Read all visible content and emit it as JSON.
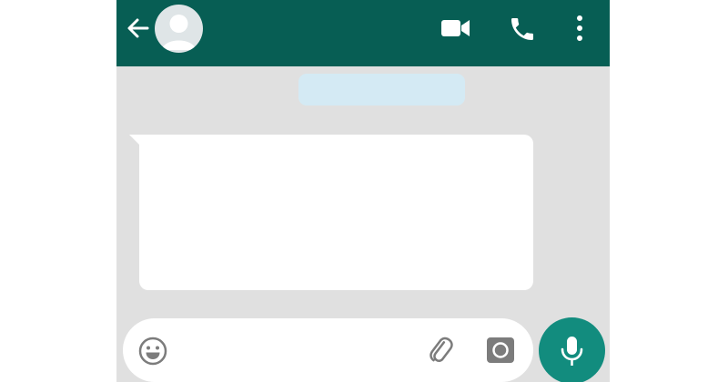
{
  "header": {
    "back_icon": "arrow-back-icon",
    "avatar_icon": "default-avatar-icon",
    "actions": [
      "video-camera-icon",
      "phone-icon",
      "more-vertical-icon"
    ]
  },
  "conversation": {
    "date_chip_text": "",
    "incoming_message": {
      "text": ""
    }
  },
  "composer": {
    "placeholder": "",
    "value": "",
    "icons": [
      "emoji-icon",
      "attachment-icon",
      "camera-icon"
    ]
  },
  "send_area": {
    "icon": "microphone-icon"
  },
  "colors": {
    "header": "#075e54",
    "chat_background": "#e0e0e0",
    "accent_button": "#128c7e",
    "date_chip": "#d4eaf4",
    "bubble": "#ffffff",
    "icon_gray": "#7c7c7c"
  }
}
